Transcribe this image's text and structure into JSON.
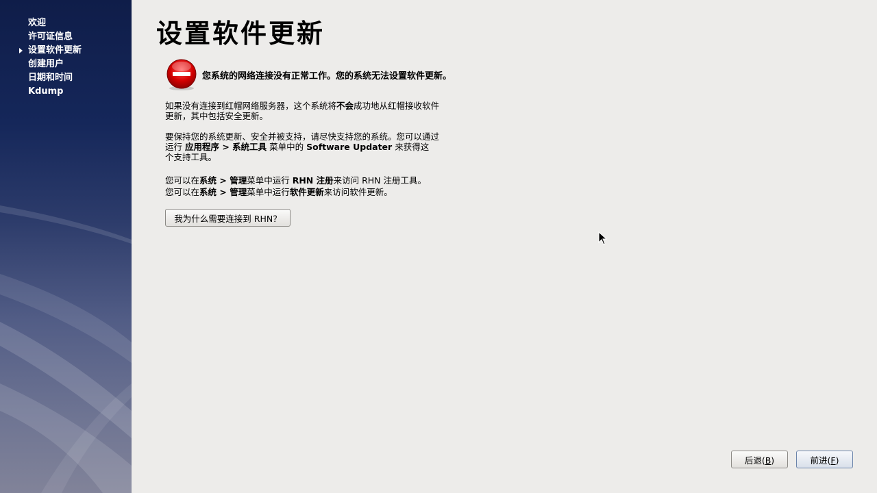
{
  "sidebar": {
    "items": [
      {
        "label": "欢迎",
        "active": false
      },
      {
        "label": "许可证信息",
        "active": false
      },
      {
        "label": "设置软件更新",
        "active": true
      },
      {
        "label": "创建用户",
        "active": false
      },
      {
        "label": "日期和时间",
        "active": false
      },
      {
        "label": "Kdump",
        "active": false
      }
    ]
  },
  "main": {
    "title": "设置软件更新",
    "alert": {
      "icon": "no-entry-icon",
      "text": "您系统的网络连接没有正常工作。您的系统无法设置软件更新。"
    },
    "para1": {
      "line1_a": "如果没有连接到红帽网络服务器，这个系统将",
      "line1_bold": "不会",
      "line1_b": "成功地从红帽接收软件",
      "line2": "更新，其中包括安全更新。"
    },
    "para2": {
      "line1": "要保持您的系统更新、安全并被支持，请尽快支持您的系统。您可以通过",
      "line2_a": "运行 ",
      "line2_bold1": "应用程序 > 系统工具",
      "line2_b": " 菜单中的 ",
      "line2_bold2": "Software Updater",
      "line2_c": " 来获得这",
      "line3": "个支持工具。"
    },
    "para3": {
      "line1_a": "您可以在",
      "line1_bold1": "系统 > 管理",
      "line1_b": "菜单中运行 ",
      "line1_bold2": "RHN 注册",
      "line1_c": "来访问 RHN 注册工具。",
      "line2_a": "您可以在",
      "line2_bold1": "系统 > 管理",
      "line2_b": "菜单中运行",
      "line2_bold2": "软件更新",
      "line2_c": "来访问软件更新。"
    },
    "why_button": "我为什么需要连接到 RHN？"
  },
  "footer": {
    "back": {
      "text": "后退(",
      "key": "B",
      "close": ")"
    },
    "forward": {
      "text": "前进(",
      "key": "F",
      "close": ")"
    }
  },
  "colors": {
    "sidebar_top": "#0f1d49",
    "sidebar_bottom": "#818399",
    "background": "#edecea",
    "alert_red": "#d40000"
  }
}
